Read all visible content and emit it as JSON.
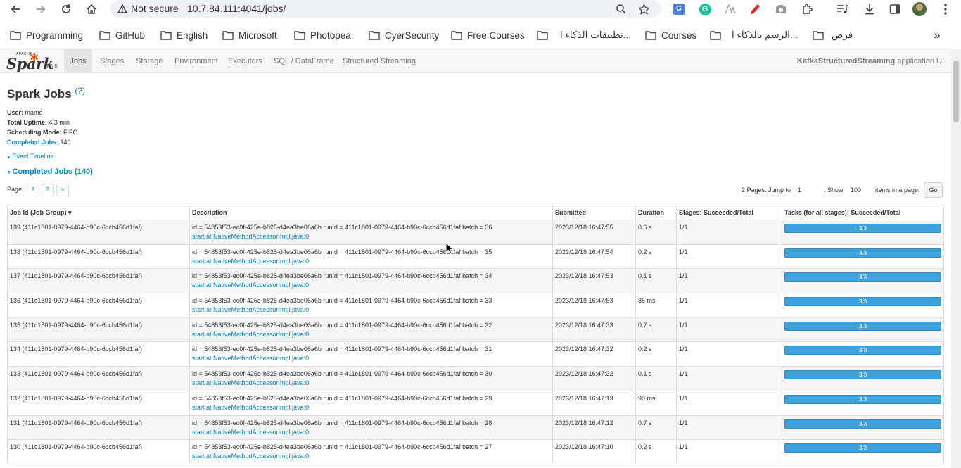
{
  "browser": {
    "security_label": "Not secure",
    "url": "10.7.84.111:4041/jobs/",
    "bookmarks": [
      "Programming",
      "GitHub",
      "English",
      "Microsoft",
      "Photopea",
      "CyerSecurity",
      "Free Courses",
      "تطبيقات الذكاء ا...",
      "Courses",
      "الرسم بالذكاء ا...",
      "فرص"
    ],
    "more_bookmarks": "»"
  },
  "spark_nav": {
    "logo_text": "Spark",
    "logo_apache": "APACHE",
    "version": "3.5.0",
    "tabs": [
      "Jobs",
      "Stages",
      "Storage",
      "Environment",
      "Executors",
      "SQL / DataFrame",
      "Structured Streaming"
    ],
    "active_tab": "Jobs",
    "app_name": "KafkaStructuredStreaming",
    "app_suffix": "application UI"
  },
  "page": {
    "title": "Spark Jobs",
    "help": "(?)",
    "user_label": "User:",
    "user": "mamo",
    "uptime_label": "Total Uptime:",
    "uptime": "4.3 min",
    "scheduling_label": "Scheduling Mode:",
    "scheduling": "FIFO",
    "completed_label": "Completed Jobs:",
    "completed_count": "140",
    "event_timeline": "Event Timeline",
    "completed_header": "Completed Jobs (140)"
  },
  "pager": {
    "label": "Page:",
    "pages": [
      "1",
      "2",
      ">"
    ],
    "pages_text": "2 Pages. Jump to",
    "jump_value": "1",
    "show_text": ". Show",
    "show_value": "100",
    "items_text": "items in a page.",
    "go": "Go"
  },
  "table": {
    "headers": [
      "Job Id (Job Group) ▾",
      "Description",
      "Submitted",
      "Duration",
      "Stages: Succeeded/Total",
      "Tasks (for all stages): Succeeded/Total"
    ],
    "rows": [
      {
        "id": "139 (411c1801-0979-4464-b90c-6ccb456d1faf)",
        "desc": "id = 54853f53-ec0f-425e-b825-d4ea3be06a6b runId = 411c1801-0979-4464-b90c-6ccb456d1faf batch = 36",
        "link": "start at NativeMethodAccessorImpl.java:0",
        "submitted": "2023/12/18 16:47:55",
        "duration": "0.6 s",
        "stages": "1/1",
        "tasks": "3/3",
        "tasks_fraction": 1.0
      },
      {
        "id": "138 (411c1801-0979-4464-b90c-6ccb456d1faf)",
        "desc": "id = 54853f53-ec0f-425e-b825-d4ea3be06a6b runId = 411c1801-0979-4464-b90c-6ccb456d1faf batch = 35",
        "link": "start at NativeMethodAccessorImpl.java:0",
        "submitted": "2023/12/18 16:47:54",
        "duration": "0.2 s",
        "stages": "1/1",
        "tasks": "3/3",
        "tasks_fraction": 1.0
      },
      {
        "id": "137 (411c1801-0979-4464-b90c-6ccb456d1faf)",
        "desc": "id = 54853f53-ec0f-425e-b825-d4ea3be06a6b runId = 411c1801-0979-4464-b90c-6ccb456d1faf batch = 34",
        "link": "start at NativeMethodAccessorImpl.java:0",
        "submitted": "2023/12/18 16:47:53",
        "duration": "0.1 s",
        "stages": "1/1",
        "tasks": "3/3",
        "tasks_fraction": 1.0
      },
      {
        "id": "136 (411c1801-0979-4464-b90c-6ccb456d1faf)",
        "desc": "id = 54853f53-ec0f-425e-b825-d4ea3be06a6b runId = 411c1801-0979-4464-b90c-6ccb456d1faf batch = 33",
        "link": "start at NativeMethodAccessorImpl.java:0",
        "submitted": "2023/12/18 16:47:53",
        "duration": "86 ms",
        "stages": "1/1",
        "tasks": "3/3",
        "tasks_fraction": 1.0
      },
      {
        "id": "135 (411c1801-0979-4464-b90c-6ccb456d1faf)",
        "desc": "id = 54853f53-ec0f-425e-b825-d4ea3be06a6b runId = 411c1801-0979-4464-b90c-6ccb456d1faf batch = 32",
        "link": "start at NativeMethodAccessorImpl.java:0",
        "submitted": "2023/12/18 16:47:33",
        "duration": "0.7 s",
        "stages": "1/1",
        "tasks": "3/3",
        "tasks_fraction": 1.0
      },
      {
        "id": "134 (411c1801-0979-4464-b90c-6ccb456d1faf)",
        "desc": "id = 54853f53-ec0f-425e-b825-d4ea3be06a6b runId = 411c1801-0979-4464-b90c-6ccb456d1faf batch = 31",
        "link": "start at NativeMethodAccessorImpl.java:0",
        "submitted": "2023/12/18 16:47:32",
        "duration": "0.2 s",
        "stages": "1/1",
        "tasks": "3/3",
        "tasks_fraction": 1.0
      },
      {
        "id": "133 (411c1801-0979-4464-b90c-6ccb456d1faf)",
        "desc": "id = 54853f53-ec0f-425e-b825-d4ea3be06a6b runId = 411c1801-0979-4464-b90c-6ccb456d1faf batch = 30",
        "link": "start at NativeMethodAccessorImpl.java:0",
        "submitted": "2023/12/18 16:47:32",
        "duration": "0.1 s",
        "stages": "1/1",
        "tasks": "3/3",
        "tasks_fraction": 1.0
      },
      {
        "id": "132 (411c1801-0979-4464-b90c-6ccb456d1faf)",
        "desc": "id = 54853f53-ec0f-425e-b825-d4ea3be06a6b runId = 411c1801-0979-4464-b90c-6ccb456d1faf batch = 29",
        "link": "start at NativeMethodAccessorImpl.java:0",
        "submitted": "2023/12/18 16:47:13",
        "duration": "90 ms",
        "stages": "1/1",
        "tasks": "3/3",
        "tasks_fraction": 1.0
      },
      {
        "id": "131 (411c1801-0979-4464-b90c-6ccb456d1faf)",
        "desc": "id = 54853f53-ec0f-425e-b825-d4ea3be06a6b runId = 411c1801-0979-4464-b90c-6ccb456d1faf batch = 28",
        "link": "start at NativeMethodAccessorImpl.java:0",
        "submitted": "2023/12/18 16:47:12",
        "duration": "0.7 s",
        "stages": "1/1",
        "tasks": "3/3",
        "tasks_fraction": 1.0
      },
      {
        "id": "130 (411c1801-0979-4464-b90c-6ccb456d1faf)",
        "desc": "id = 54853f53-ec0f-425e-b825-d4ea3be06a6b runId = 411c1801-0979-4464-b90c-6ccb456d1faf batch = 27",
        "link": "start at NativeMethodAccessorImpl.java:0",
        "submitted": "2023/12/18 16:47:10",
        "duration": "0.2 s",
        "stages": "1/1",
        "tasks": "3/3",
        "tasks_fraction": 1.0
      }
    ]
  }
}
